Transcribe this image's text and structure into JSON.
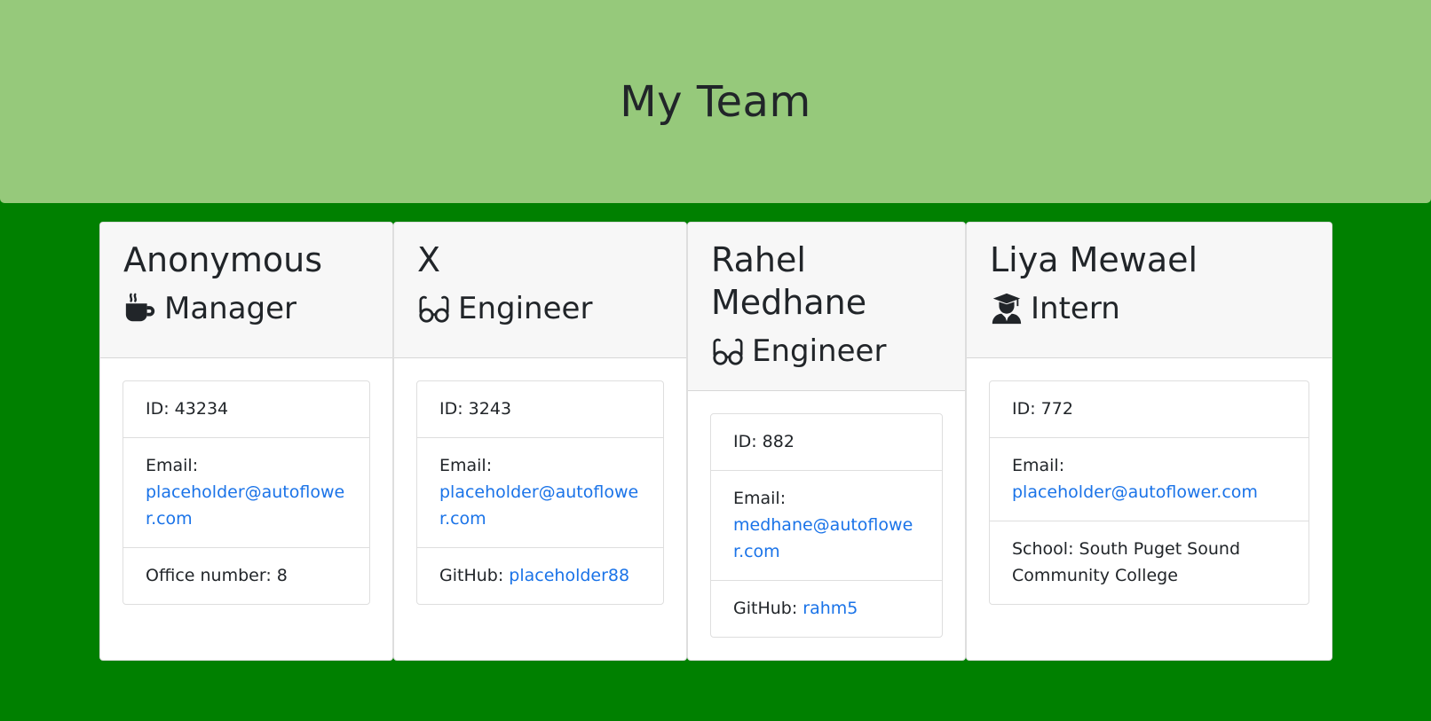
{
  "header": {
    "title": "My Team"
  },
  "employees": [
    {
      "name": "Anonymous",
      "role": "Manager",
      "role_icon": "mug-icon",
      "id_text": "ID: 43234",
      "email_label": "Email:",
      "email": "placeholder@autoflower.com",
      "extra_label": "Office number: 8",
      "extra_link": ""
    },
    {
      "name": "X",
      "role": "Engineer",
      "role_icon": "glasses-icon",
      "id_text": "ID: 3243",
      "email_label": "Email:",
      "email": "placeholder@autoflower.com",
      "extra_label": "GitHub: ",
      "extra_link": "placeholder88"
    },
    {
      "name": "Rahel Medhane",
      "role": "Engineer",
      "role_icon": "glasses-icon",
      "id_text": "ID: 882",
      "email_label": "Email:",
      "email": "medhane@autoflower.com",
      "extra_label": "GitHub: ",
      "extra_link": "rahm5"
    },
    {
      "name": "Liya Mewael",
      "role": "Intern",
      "role_icon": "graduate-icon",
      "id_text": "ID: 772",
      "email_label": "Email:",
      "email": "placeholder@autoflower.com",
      "extra_label": "School: South Puget Sound Community College",
      "extra_link": ""
    }
  ],
  "colors": {
    "page_background": "#008000",
    "header_background": "#96c97b",
    "link": "#1a73e8"
  }
}
